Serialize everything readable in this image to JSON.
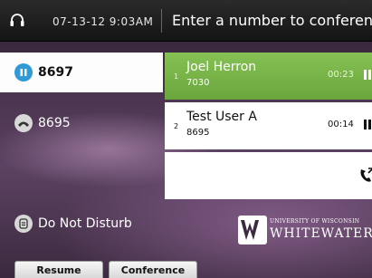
{
  "header": {
    "datetime": "07-13-12 9:03AM",
    "title": "Enter a number to conference",
    "headset_icon": "headset-icon"
  },
  "lines": [
    {
      "label": "8697",
      "icon": "pause-icon",
      "state": "active",
      "icon_color": "#2f9ad6"
    },
    {
      "label": "8695",
      "icon": "phone-handset-icon",
      "state": "idle"
    }
  ],
  "dnd": {
    "label": "Do Not Disturb",
    "icon": "do-not-disturb-icon"
  },
  "calls": [
    {
      "index": "1",
      "name": "Joel Herron",
      "number": "7030",
      "timer": "00:23",
      "highlight_color": "#7ab549"
    },
    {
      "index": "2",
      "name": "Test User A",
      "number": "8695",
      "timer": "00:14"
    }
  ],
  "conference_slot": {
    "icon": "call-transfer-icon"
  },
  "logo": {
    "line1": "UNIVERSITY OF WISCONSIN",
    "line2": "WHITEWATER",
    "icon": "uw-logo-icon"
  },
  "softkeys": [
    {
      "label": "Resume"
    },
    {
      "label": "Conference"
    }
  ]
}
